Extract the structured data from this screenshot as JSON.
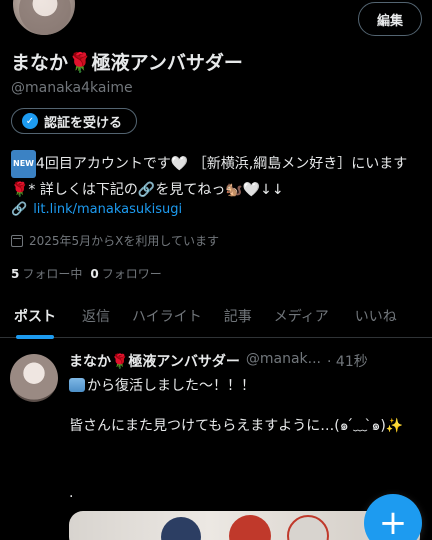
{
  "profile": {
    "display_name": "まなか🌹極液アンバサダー",
    "handle": "@manaka4kaime",
    "edit_label": "編集",
    "verify_label": "認証を受ける",
    "bio_line1": "4回目アカウントです🤍 ［新横浜,綱島メン好き］にいます🌹* 詳しくは下記の🔗を見てねっ🐿️🤍↓↓",
    "bio_new_badge": "NEW",
    "link_text": "lit.link/manakasukisugi",
    "joined_text": "2025年5月からXを利用しています",
    "following_count": "5",
    "following_label": "フォロー中",
    "followers_count": "0",
    "followers_label": "フォロワー"
  },
  "tabs": [
    "ポスト",
    "返信",
    "ハイライト",
    "記事",
    "メディア",
    "いいね"
  ],
  "post": {
    "author": "まなか🌹極液アンバサダー",
    "handle": "@manak...",
    "time": "· 41秒",
    "line1": "から復活しました〜！！！",
    "line2": "皆さんにまた見つけてもらえますように…(๑ ́﹏ ̀๑)✨",
    "dot": "."
  },
  "fab_label": "+",
  "colors": {
    "accent": "#1d9bf0",
    "background": "#000000",
    "secondary_text": "#71767b",
    "border": "#2f3336"
  },
  "icons": [
    "verified-badge-icon",
    "link-icon",
    "calendar-icon",
    "plus-icon"
  ]
}
